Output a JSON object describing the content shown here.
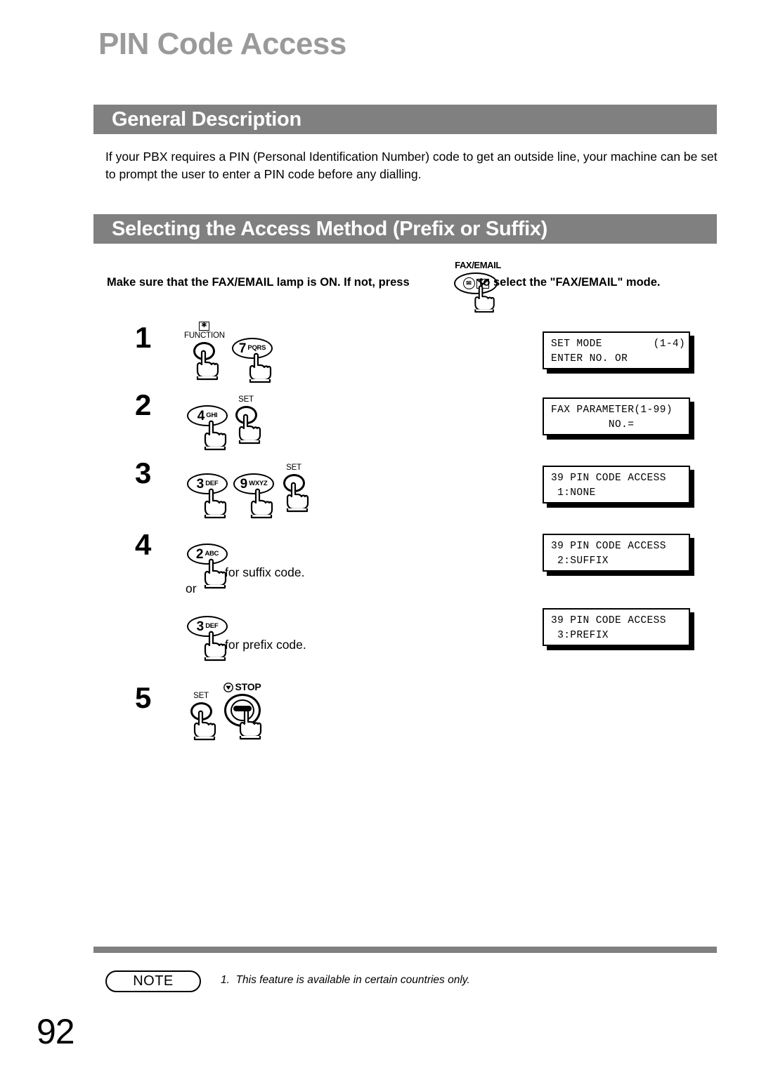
{
  "page": {
    "title": "PIN Code Access",
    "number": "92"
  },
  "sections": [
    {
      "id": "general",
      "heading": "General Description",
      "paragraph": "If your PBX requires a PIN (Personal Identification Number) code to get an outside line, your machine can be set to prompt the user to enter a PIN code before any dialling."
    },
    {
      "id": "selecting",
      "heading": "Selecting the Access Method (Prefix or Suffix)"
    }
  ],
  "intro": {
    "text_before": "Make sure that the FAX/EMAIL lamp is ON.  If not, press",
    "text_after": "to select the \"FAX/EMAIL\" mode.",
    "button_label": "FAX/EMAIL",
    "fax_glyph": "fax-icon",
    "envelope_glyph": "envelope-icon"
  },
  "steps": [
    {
      "number": "1",
      "keys": [
        {
          "type": "round",
          "cap": "FUNCTION",
          "badge": "✱",
          "name": "function-key"
        },
        {
          "type": "oval",
          "digit": "7",
          "letters": "PQRS",
          "name": "key-7-pqrs"
        }
      ],
      "lcd": {
        "line1": "SET MODE        (1-4)",
        "line2": "ENTER NO. OR"
      }
    },
    {
      "number": "2",
      "keys": [
        {
          "type": "oval",
          "digit": "4",
          "letters": "GHI",
          "name": "key-4-ghi"
        },
        {
          "type": "round",
          "cap": "SET",
          "name": "set-key"
        }
      ],
      "lcd": {
        "line1": "FAX PARAMETER(1-99)",
        "line2": "         NO.="
      }
    },
    {
      "number": "3",
      "keys": [
        {
          "type": "oval",
          "digit": "3",
          "letters": "DEF",
          "name": "key-3-def"
        },
        {
          "type": "oval",
          "digit": "9",
          "letters": "WXYZ",
          "name": "key-9-wxyz"
        },
        {
          "type": "round",
          "cap": "SET",
          "name": "set-key"
        }
      ],
      "lcd": {
        "line1": "39 PIN CODE ACCESS",
        "line2": " 1:NONE"
      }
    },
    {
      "number": "4",
      "options": [
        {
          "key": {
            "type": "oval",
            "digit": "2",
            "letters": "ABC",
            "name": "key-2-abc"
          },
          "caption": "for suffix code.",
          "lcd": {
            "line1": "39 PIN CODE ACCESS",
            "line2": " 2:SUFFIX"
          }
        },
        {
          "separator": "or"
        },
        {
          "key": {
            "type": "oval",
            "digit": "3",
            "letters": "DEF",
            "name": "key-3-def"
          },
          "caption": "for prefix code.",
          "lcd": {
            "line1": "39 PIN CODE ACCESS",
            "line2": " 3:PREFIX"
          }
        }
      ]
    },
    {
      "number": "5",
      "keys": [
        {
          "type": "round",
          "cap": "SET",
          "name": "set-key"
        },
        {
          "type": "stop",
          "cap": "STOP",
          "name": "stop-key"
        }
      ]
    }
  ],
  "note": {
    "label": "NOTE",
    "item_number": "1.",
    "item_text": "This feature is available in certain countries only."
  },
  "colors": {
    "bar_gray": "#808080",
    "title_gray": "#9a9a9a",
    "text_black": "#000000"
  }
}
